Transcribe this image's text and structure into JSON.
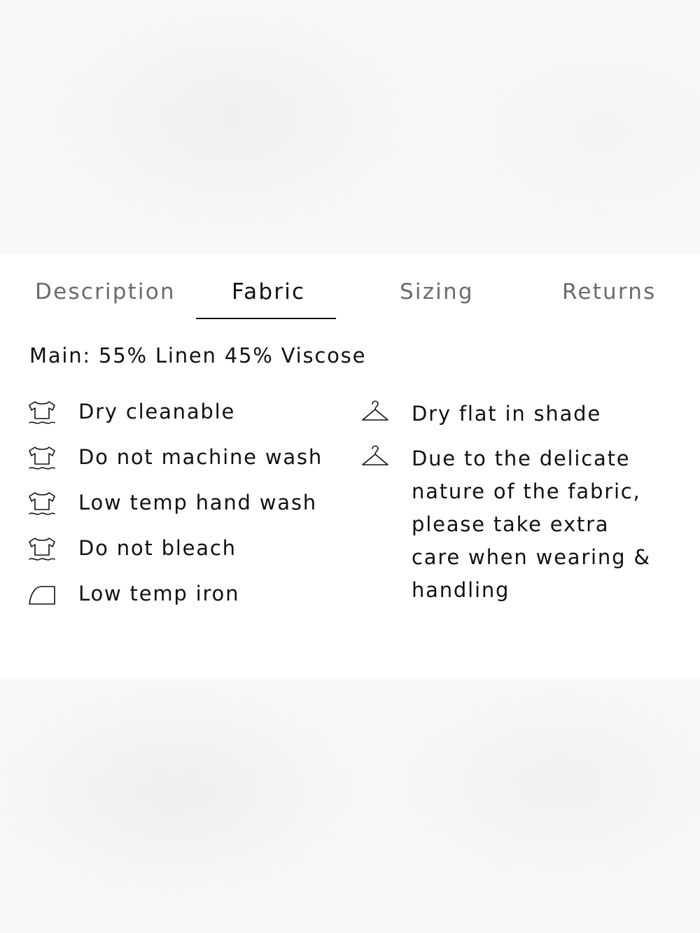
{
  "tabs": [
    {
      "label": "Description",
      "active": false
    },
    {
      "label": "Fabric",
      "active": true
    },
    {
      "label": "Sizing",
      "active": false
    },
    {
      "label": "Returns",
      "active": false
    }
  ],
  "fabric": {
    "composition": "Main: 55% Linen 45% Viscose",
    "care_left": [
      {
        "icon": "shirt-wash-icon",
        "text": "Dry cleanable"
      },
      {
        "icon": "shirt-wash-icon",
        "text": "Do not machine wash"
      },
      {
        "icon": "shirt-wash-icon",
        "text": "Low temp hand wash"
      },
      {
        "icon": "shirt-wash-icon",
        "text": "Do not bleach"
      },
      {
        "icon": "iron-icon",
        "text": "Low temp iron"
      }
    ],
    "care_right": [
      {
        "icon": "hanger-icon",
        "text": "Dry flat in shade"
      },
      {
        "icon": "hanger-icon",
        "text": "Due to the delicate nature of the fabric, please take extra care when wearing & handling"
      }
    ]
  },
  "colors": {
    "text": "#111111",
    "inactive_tab": "#6b6b6b",
    "panel_background": "#ffffff"
  }
}
